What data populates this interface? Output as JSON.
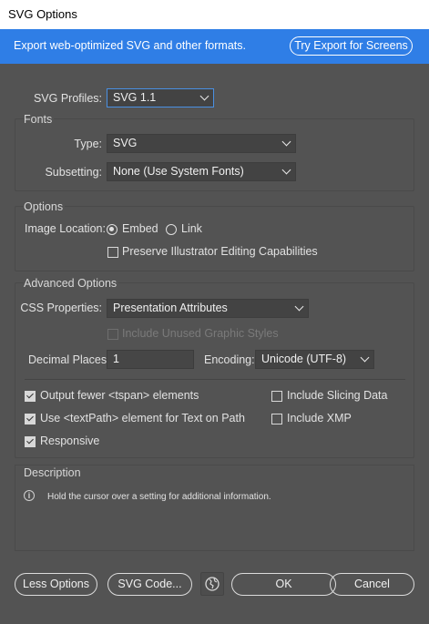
{
  "window": {
    "title": "SVG Options"
  },
  "banner": {
    "message": "Export web-optimized SVG and other formats.",
    "button": "Try Export for Screens"
  },
  "profiles": {
    "label": "SVG Profiles:",
    "value": "SVG 1.1"
  },
  "fonts": {
    "section": "Fonts",
    "type_label": "Type:",
    "type_value": "SVG",
    "subsetting_label": "Subsetting:",
    "subsetting_value": "None (Use System Fonts)"
  },
  "options": {
    "section": "Options",
    "image_location_label": "Image Location:",
    "embed_label": "Embed",
    "link_label": "Link",
    "preserve_label": "Preserve Illustrator Editing Capabilities"
  },
  "advanced": {
    "section": "Advanced Options",
    "css_label": "CSS Properties:",
    "css_value": "Presentation Attributes",
    "include_unused_label": "Include Unused Graphic Styles",
    "decimal_label": "Decimal Places:",
    "decimal_value": "1",
    "encoding_label": "Encoding:",
    "encoding_value": "Unicode (UTF-8)",
    "output_fewer_label": "Output fewer <tspan> elements",
    "use_textpath_label": "Use <textPath> element for Text on Path",
    "responsive_label": "Responsive",
    "include_slicing_label": "Include Slicing Data",
    "include_xmp_label": "Include XMP"
  },
  "description": {
    "section": "Description",
    "text": "Hold the cursor over a setting for additional information."
  },
  "footer": {
    "less_options": "Less Options",
    "svg_code": "SVG Code...",
    "ok": "OK",
    "cancel": "Cancel"
  }
}
